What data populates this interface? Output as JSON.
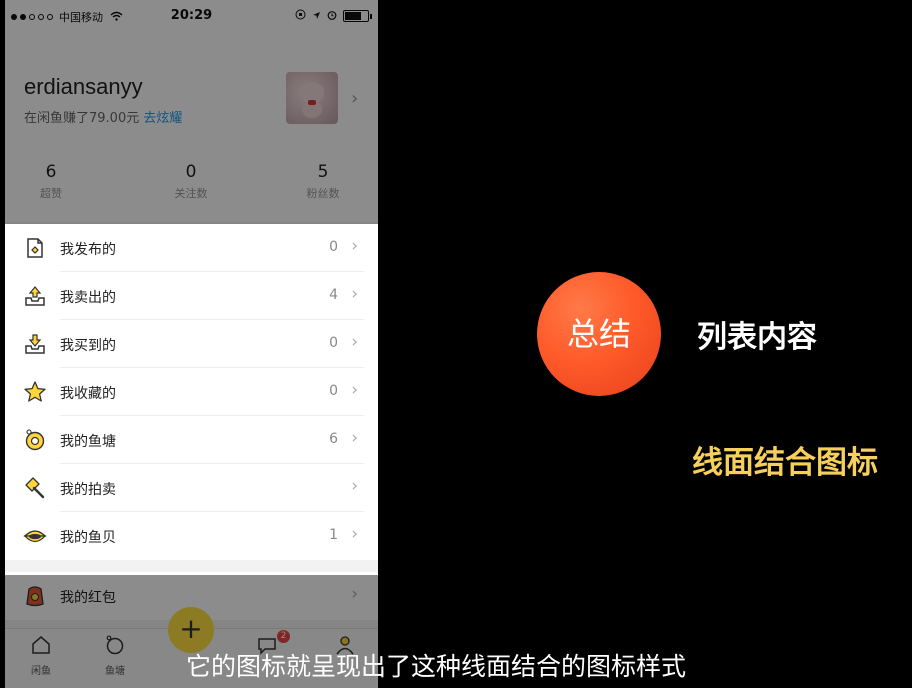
{
  "status_bar": {
    "carrier": "中国移动",
    "time": "20:29"
  },
  "profile": {
    "username": "erdiansanyy",
    "earned_text": "在闲鱼赚了79.00元",
    "earned_link": "去炫耀"
  },
  "stats": [
    {
      "value": "6",
      "label": "超赞"
    },
    {
      "value": "0",
      "label": "关注数"
    },
    {
      "value": "5",
      "label": "粉丝数"
    }
  ],
  "menu": {
    "items": [
      {
        "label": "我发布的",
        "count": "0",
        "icon": "publish-doc-icon"
      },
      {
        "label": "我卖出的",
        "count": "4",
        "icon": "sold-tray-icon"
      },
      {
        "label": "我买到的",
        "count": "0",
        "icon": "bought-tray-icon"
      },
      {
        "label": "我收藏的",
        "count": "0",
        "icon": "star-icon"
      },
      {
        "label": "我的鱼塘",
        "count": "6",
        "icon": "pond-icon"
      },
      {
        "label": "我的拍卖",
        "count": "",
        "icon": "auction-hammer-icon"
      },
      {
        "label": "我的鱼贝",
        "count": "1",
        "icon": "shell-icon"
      }
    ]
  },
  "wallet": {
    "label": "我的红包",
    "icon": "red-packet-icon"
  },
  "tabbar": {
    "tabs": [
      {
        "label": "闲鱼",
        "icon": "home-icon"
      },
      {
        "label": "鱼塘",
        "icon": "pond-tab-icon"
      },
      {
        "label": "",
        "icon": "message-icon"
      },
      {
        "label": "",
        "icon": "me-icon"
      }
    ],
    "fab_glyph": "+",
    "message_badge": "2"
  },
  "slide": {
    "badge": "总结",
    "title": "列表内容",
    "highlight": "线面结合图标",
    "subtitle": "它的图标就呈现出了这种线面结合的图标样式"
  },
  "colors": {
    "badge_orange": "#ff5a2a",
    "highlight_yellow": "#f7d05b",
    "link_blue": "#1e9be8",
    "fab_yellow": "#ffe13e"
  }
}
